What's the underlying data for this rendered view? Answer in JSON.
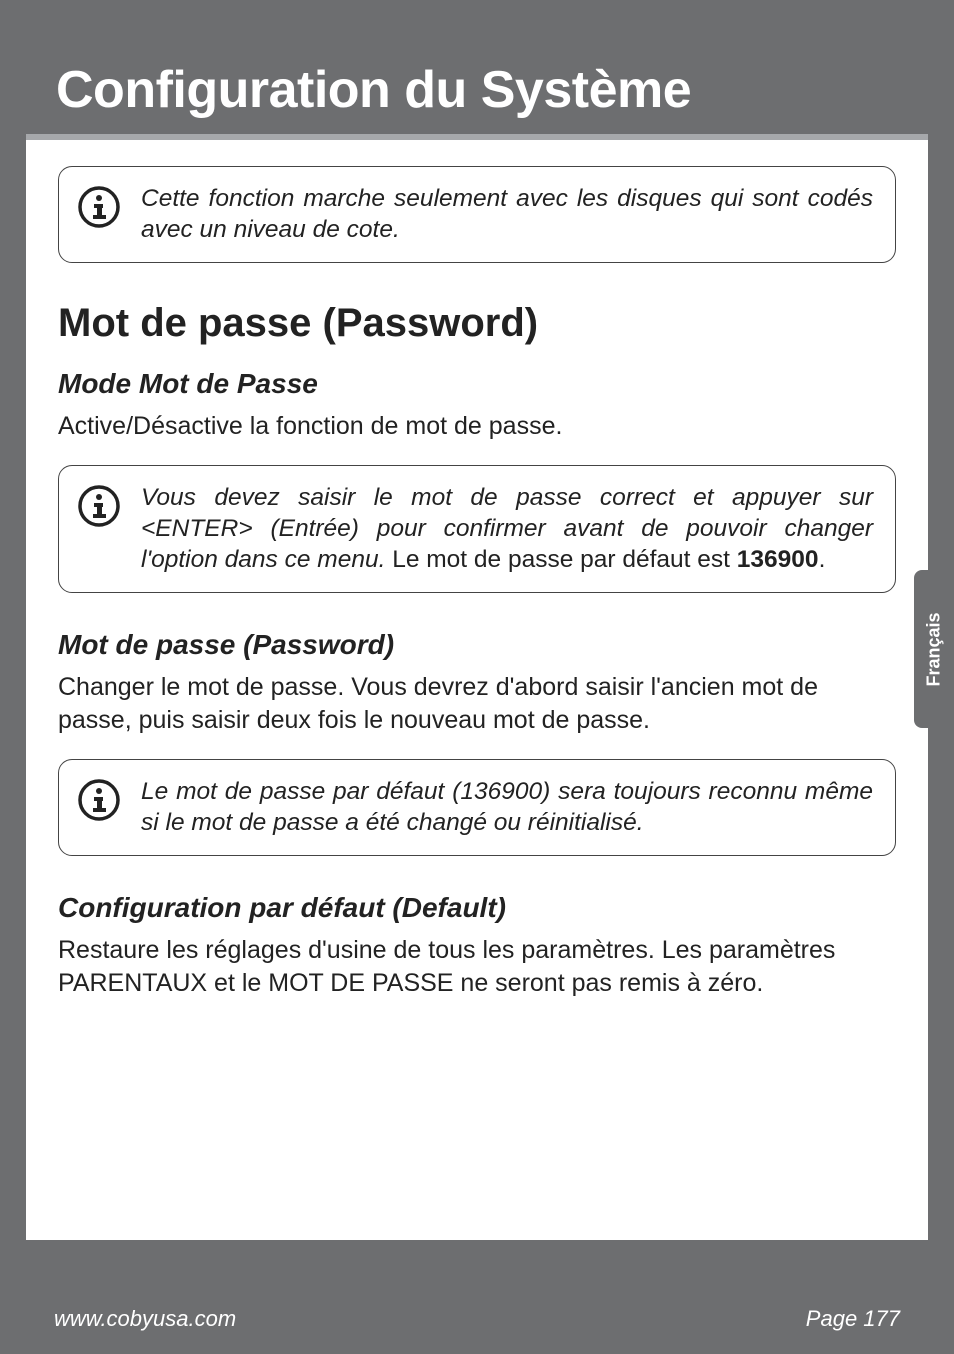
{
  "header": {
    "title": "Configuration du Système"
  },
  "info1": {
    "text": "Cette fonction marche seulement avec les disques qui sont codés avec un niveau de cote."
  },
  "section1": {
    "heading": "Mot de passe (Password)",
    "sub1_heading": "Mode Mot de Passe",
    "sub1_body": "Active/Désactive la fonction de mot de passe.",
    "info2_pre": "Vous devez saisir le mot de passe correct et appuyer sur <ENTER> (Entrée) pour confirmer avant de pouvoir changer l'option dans ce menu. ",
    "info2_nonital": "Le mot de passe par défaut est ",
    "info2_bold": "136900",
    "info2_post": ".",
    "sub2_heading": "Mot de passe (Password)",
    "sub2_body": "Changer le mot de passe. Vous devrez d'abord saisir l'ancien mot de passe, puis saisir deux fois le nouveau mot de passe.",
    "info3_text": "Le mot de passe par défaut (136900) sera toujours reconnu même si le mot de passe a été changé ou réinitialisé.",
    "sub3_heading": "Configuration par défaut (Default)",
    "sub3_body": "Restaure les réglages d'usine de tous les paramètres. Les paramètres PARENTAUX et le MOT DE PASSE ne seront pas remis à zéro."
  },
  "sidetab": {
    "label": "Français"
  },
  "footer": {
    "left": "www.cobyusa.com",
    "right": "Page 177"
  }
}
